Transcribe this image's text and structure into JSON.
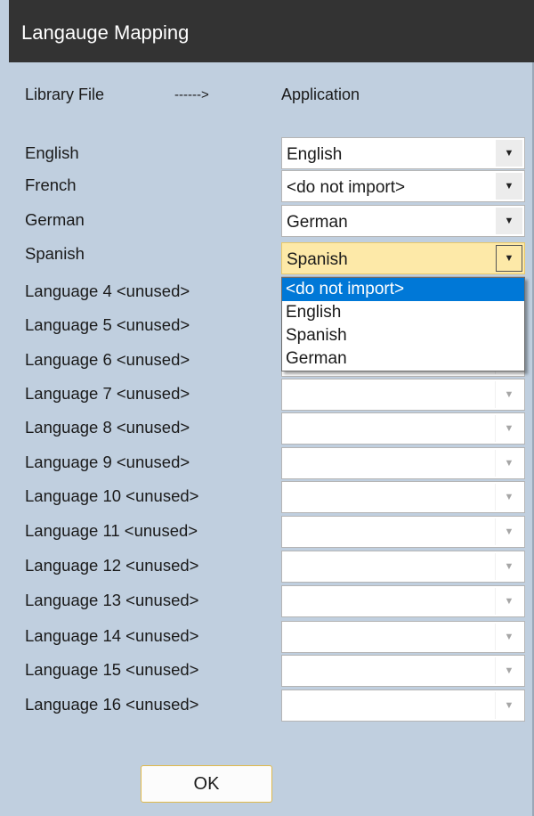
{
  "window": {
    "title": "Langauge Mapping"
  },
  "header": {
    "left": "Library File",
    "arrow": "------>",
    "right": "Application"
  },
  "rows": [
    {
      "label": "English",
      "value": "English",
      "enabled": true
    },
    {
      "label": "French",
      "value": "<do not import>",
      "enabled": true
    },
    {
      "label": "German",
      "value": "German",
      "enabled": true
    },
    {
      "label": "Spanish",
      "value": "Spanish",
      "enabled": true,
      "focused": true
    },
    {
      "label": "Language 4 <unused>",
      "value": "",
      "enabled": false
    },
    {
      "label": "Language 5 <unused>",
      "value": "",
      "enabled": false
    },
    {
      "label": "Language 6 <unused>",
      "value": "",
      "enabled": false
    },
    {
      "label": "Language 7 <unused>",
      "value": "",
      "enabled": false
    },
    {
      "label": "Language 8 <unused>",
      "value": "",
      "enabled": false
    },
    {
      "label": "Language 9 <unused>",
      "value": "",
      "enabled": false
    },
    {
      "label": "Language 10 <unused>",
      "value": "",
      "enabled": false
    },
    {
      "label": "Language 11 <unused>",
      "value": "",
      "enabled": false
    },
    {
      "label": "Language 12 <unused>",
      "value": "",
      "enabled": false
    },
    {
      "label": "Language 13 <unused>",
      "value": "",
      "enabled": false
    },
    {
      "label": "Language 14 <unused>",
      "value": "",
      "enabled": false
    },
    {
      "label": "Language 15 <unused>",
      "value": "",
      "enabled": false
    },
    {
      "label": "Language 16 <unused>",
      "value": "",
      "enabled": false
    }
  ],
  "dropdown": {
    "options": [
      "<do not import>",
      "English",
      "Spanish",
      "German"
    ],
    "highlighted": 0
  },
  "ok_label": "OK",
  "icons": {
    "combo_arrow": "chevron-down-icon"
  },
  "colors": {
    "background": "#c0cfdf",
    "titlebar": "#333333",
    "selection": "#0078d7",
    "focused": "#fde9a8"
  }
}
